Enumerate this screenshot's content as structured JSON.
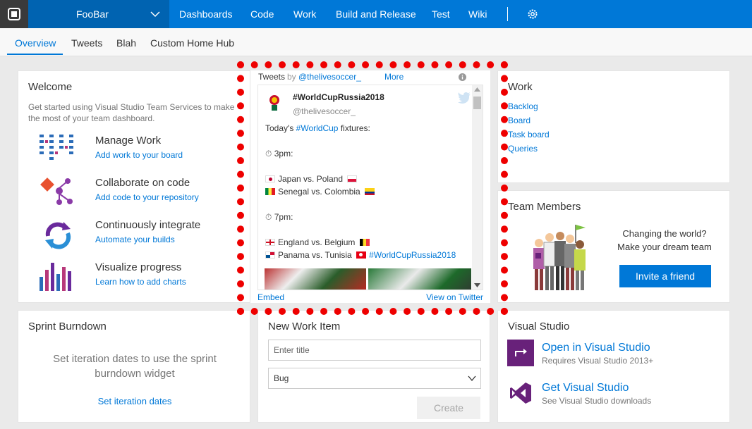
{
  "topbar": {
    "project_name": "FooBar",
    "nav": [
      "Dashboards",
      "Code",
      "Work",
      "Build and Release",
      "Test",
      "Wiki"
    ]
  },
  "subnav": {
    "tabs": [
      "Overview",
      "Tweets",
      "Blah",
      "Custom Home Hub"
    ],
    "active": "Overview"
  },
  "welcome": {
    "title": "Welcome",
    "description": "Get started using Visual Studio Team Services to make the most of your team dashboard.",
    "items": [
      {
        "title": "Manage Work",
        "link": "Add work to your board",
        "icon": "kanban-board-icon"
      },
      {
        "title": "Collaborate on code",
        "link": "Add code to your repository",
        "icon": "git-branch-icon"
      },
      {
        "title": "Continuously integrate",
        "link": "Automate your builds",
        "icon": "build-cycle-icon"
      },
      {
        "title": "Visualize progress",
        "link": "Learn how to add charts",
        "icon": "bar-chart-icon"
      }
    ]
  },
  "tweets": {
    "label": "Tweets",
    "by": "by",
    "handle": "@thelivesoccer_",
    "more": "More",
    "tweet_title": "#WorldCupRussia2018",
    "tweet_handle": "@thelivesoccer_",
    "intro_prefix": "Today's",
    "intro_hashtag": "#WorldCup",
    "intro_suffix": "fixtures:",
    "time1": "3pm:",
    "match1": "Japan vs. Poland",
    "match2": "Senegal vs. Colombia",
    "time2": "7pm:",
    "match3": "England vs. Belgium",
    "match4": "Panama vs. Tunisia",
    "match4_hashtag": "#WorldCupRussia2018",
    "embed": "Embed",
    "view_on_twitter": "View on Twitter"
  },
  "work": {
    "title": "Work",
    "links": [
      "Backlog",
      "Board",
      "Task board",
      "Queries"
    ]
  },
  "team": {
    "title": "Team Members",
    "line1": "Changing the world?",
    "line2": "Make your dream team",
    "button": "Invite a friend"
  },
  "sprint": {
    "title": "Sprint Burndown",
    "message": "Set iteration dates to use the sprint burndown widget",
    "link": "Set iteration dates"
  },
  "new_work_item": {
    "title": "New Work Item",
    "placeholder": "Enter title",
    "type": "Bug",
    "create": "Create"
  },
  "visual_studio": {
    "title": "Visual Studio",
    "open_title": "Open in Visual Studio",
    "open_sub": "Requires Visual Studio 2013+",
    "get_title": "Get Visual Studio",
    "get_sub": "See Visual Studio downloads"
  }
}
